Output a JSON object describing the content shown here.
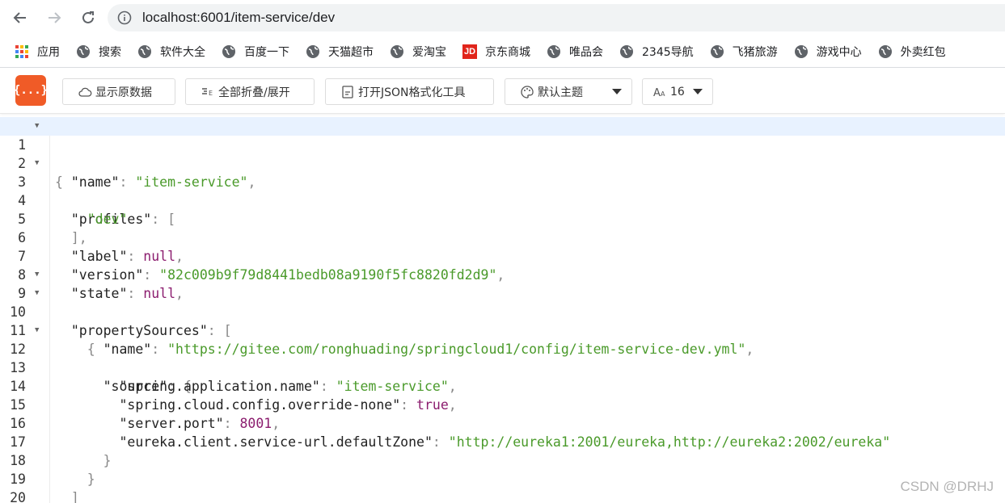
{
  "browser": {
    "url_host": "localhost",
    "url_rest": ":6001/item-service/dev"
  },
  "bookmarks": [
    {
      "label": "应用",
      "icon": "apps-grid-icon"
    },
    {
      "label": "搜索",
      "icon": "globe-icon"
    },
    {
      "label": "软件大全",
      "icon": "globe-icon"
    },
    {
      "label": "百度一下",
      "icon": "globe-icon"
    },
    {
      "label": "天猫超市",
      "icon": "globe-icon"
    },
    {
      "label": "爱淘宝",
      "icon": "globe-icon"
    },
    {
      "label": "京东商城",
      "icon": "jd-logo-icon",
      "badge": "JD"
    },
    {
      "label": "唯品会",
      "icon": "globe-icon"
    },
    {
      "label": "2345导航",
      "icon": "globe-icon"
    },
    {
      "label": "飞猪旅游",
      "icon": "globe-icon"
    },
    {
      "label": "游戏中心",
      "icon": "globe-icon"
    },
    {
      "label": "外卖红包",
      "icon": "globe-icon"
    }
  ],
  "toolbar": {
    "logo": "{...}",
    "raw_label": "显示原数据",
    "fold_label": "全部折叠/展开",
    "formatter_label": "打开JSON格式化工具",
    "theme_label": "默认主题",
    "font_size": "16"
  },
  "lines": [
    {
      "n": "1",
      "fold": true
    },
    {
      "n": "2"
    },
    {
      "n": "3",
      "fold": true
    },
    {
      "n": "4"
    },
    {
      "n": "5"
    },
    {
      "n": "6"
    },
    {
      "n": "7"
    },
    {
      "n": "8"
    },
    {
      "n": "9",
      "fold": true
    },
    {
      "n": "10",
      "fold": true
    },
    {
      "n": "11"
    },
    {
      "n": "12",
      "fold": true
    },
    {
      "n": "13"
    },
    {
      "n": "14"
    },
    {
      "n": "15"
    },
    {
      "n": "16"
    },
    {
      "n": "17"
    },
    {
      "n": "18"
    },
    {
      "n": "19"
    },
    {
      "n": "20"
    }
  ],
  "json": {
    "k_name": "\"name\"",
    "v_name": "\"item-service\"",
    "k_profiles": "\"profiles\"",
    "v_profile0": "\"dev\"",
    "k_label": "\"label\"",
    "v_null": "null",
    "k_version": "\"version\"",
    "v_version": "\"82c009b9f79d8441bedb08a9190f5fc8820fd2d9\"",
    "k_state": "\"state\"",
    "k_propertySources": "\"propertySources\"",
    "v_ps_name": "\"https://gitee.com/ronghuading/springcloud1/config/item-service-dev.yml\"",
    "k_source": "\"source\"",
    "k_app_name": "\"spring.application.name\"",
    "k_override": "\"spring.cloud.config.override-none\"",
    "v_true": "true",
    "k_port": "\"server.port\"",
    "v_port": "8001",
    "k_eureka": "\"eureka.client.service-url.defaultZone\"",
    "v_eureka": "\"http://eureka1:2001/eureka,http://eureka2:2002/eureka\""
  },
  "watermark": "CSDN @DRHJ"
}
